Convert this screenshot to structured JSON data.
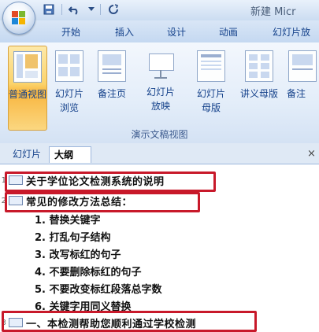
{
  "window": {
    "title": "新建 Micr"
  },
  "qat": {
    "save_icon": "save-icon",
    "undo_icon": "undo-icon",
    "redo_icon": "redo-icon"
  },
  "ribbon_tabs": [
    "开始",
    "插入",
    "设计",
    "动画",
    "幻灯片放"
  ],
  "view_buttons": [
    {
      "label": "普通视图",
      "icon": "normal-view-icon",
      "active": true
    },
    {
      "label": "幻灯片浏览",
      "icon": "slide-sorter-icon"
    },
    {
      "label": "备注页",
      "icon": "notes-page-icon"
    },
    {
      "label": "幻灯片放映",
      "icon": "slideshow-icon"
    },
    {
      "label": "幻灯片母版",
      "icon": "slide-master-icon"
    },
    {
      "label": "讲义母版",
      "icon": "handout-master-icon"
    },
    {
      "label": "备注",
      "icon": "notes-master-icon"
    }
  ],
  "ribbon_group_caption": "演示文稿视图",
  "pane": {
    "tab_slides": "幻灯片",
    "tab_outline": "大纲",
    "close_glyph": "×"
  },
  "outline": {
    "slide1": {
      "number": "1",
      "title": "关于学位论文检测系统的说明"
    },
    "slide2": {
      "number": "2",
      "title": "常见的修改方法总结："
    },
    "bullets": [
      "1. 替换关键字",
      "2. 打乱句子结构",
      "3. 改写标红的句子",
      "4. 不要删除标红的句子",
      "5. 不要改变标红段落总字数",
      "6. 关键字用同义替换"
    ],
    "slide3": {
      "number": "3",
      "title": "一、本检测帮助您顺利通过学校检测"
    }
  },
  "colors": {
    "highlight_box": "#c8192a",
    "ribbon_text": "#15428b",
    "active_button": "#f8b640"
  }
}
